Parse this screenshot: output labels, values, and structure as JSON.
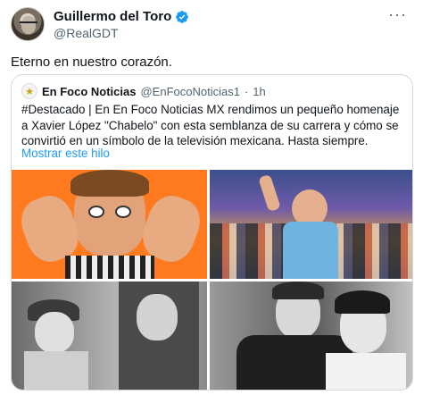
{
  "author": {
    "display_name": "Guillermo del Toro",
    "handle": "@RealGDT",
    "more_glyph": "···"
  },
  "tweet": {
    "text": "Eterno en nuestro corazón."
  },
  "quote": {
    "name": "En Foco Noticias",
    "handle": "@EnFocoNoticias1",
    "separator": "·",
    "time": "1h",
    "body": "#Destacado | En En Foco Noticias MX rendimos un pequeño homenaje a Xavier López \"Chabelo\" con esta semblanza de su carrera y cómo se convirtió en un símbolo de la televisión mexicana. Hasta siempre.",
    "show_thread": "Mostrar este hilo"
  },
  "colors": {
    "accent": "#1d9bf0",
    "muted": "#536471",
    "border": "#cfd9de"
  }
}
